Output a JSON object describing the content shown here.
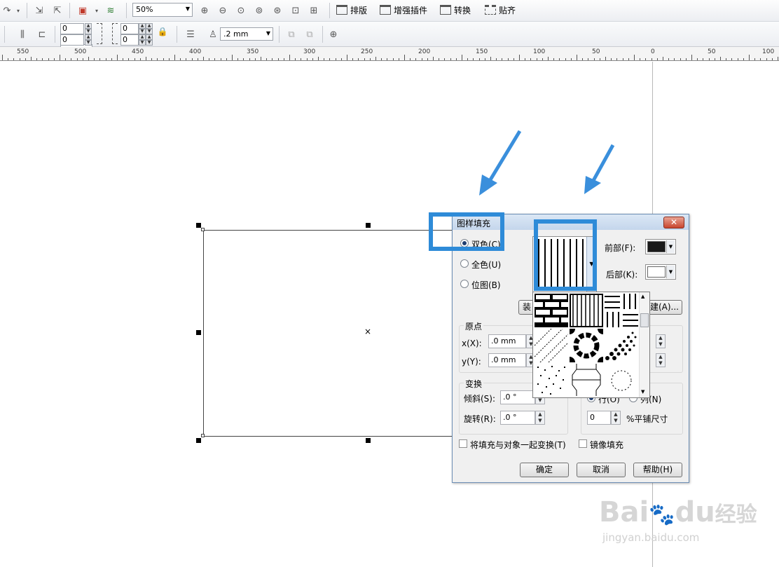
{
  "toolbar": {
    "zoom_value": "50%",
    "menu_items": [
      "排版",
      "增强插件",
      "转换",
      "贴齐"
    ],
    "pos_x1": "0",
    "pos_y1": "0",
    "pos_x2": "0",
    "pos_y2": "0",
    "outline_width": ".2 mm"
  },
  "ruler": {
    "labels": [
      "550",
      "500",
      "450",
      "400",
      "350",
      "300",
      "250",
      "200",
      "150",
      "100",
      "50",
      "0",
      "50",
      "100"
    ]
  },
  "dialog": {
    "title": "图样填充",
    "close_label": "✕",
    "radio_two_color": "双色(C)",
    "radio_full_color": "全色(U)",
    "radio_bitmap": "位图(B)",
    "front_label": "前部(F):",
    "back_label": "后部(K):",
    "front_color": "#1a1a1a",
    "back_color": "#ffffff",
    "load_button_partial": "装",
    "create_button_partial": "建(A)...",
    "origin_group": "原点",
    "x_label": "x(X):",
    "x_value": ".0 mm",
    "y_label": "y(Y):",
    "y_value": ".0 mm",
    "transform_group": "变换",
    "skew_label": "倾斜(S):",
    "skew_value": ".0 °",
    "rotate_label": "旋转(R):",
    "rotate_value": ".0 °",
    "row_label_partial": "行(O)",
    "col_label_partial": "列(N)",
    "tile_value": "0",
    "tile_label": "%平铺尺寸",
    "transform_with_object": "将填充与对象一起变换(T)",
    "mirror_fill": "镜像填充",
    "ok": "确定",
    "cancel": "取消",
    "help": "帮助(H)"
  },
  "colors": {
    "highlight": "#2e8bd8",
    "arrow": "#3a8fdc"
  },
  "watermark": {
    "brand": "Bai",
    "brand2": "du",
    "cn": "经验",
    "url": "jingyan.baidu.com"
  }
}
